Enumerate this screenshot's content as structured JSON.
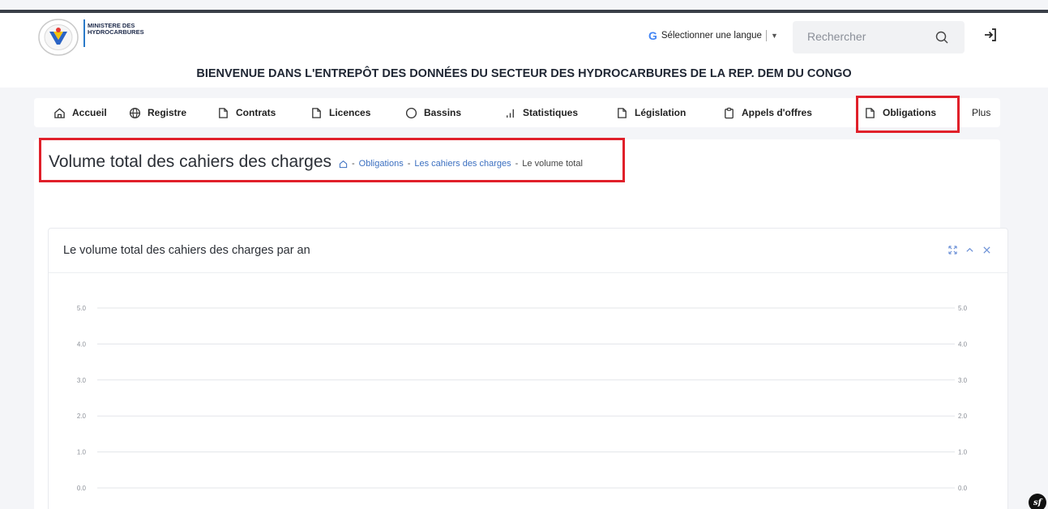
{
  "header": {
    "logo_text": "MINISTERE DES HYDROCARBURES",
    "language_label": "Sélectionner une langue",
    "language_arrow": "▼",
    "search_placeholder": "Rechercher",
    "welcome": "BIENVENUE DANS L'ENTREPÔT DES DONNÉES DU SECTEUR DES HYDROCARBURES DE LA REP. DEM DU CONGO"
  },
  "nav": {
    "items": [
      {
        "label": "Accueil",
        "icon": "home-icon"
      },
      {
        "label": "Registre",
        "icon": "globe-icon"
      },
      {
        "label": "Contrats",
        "icon": "document-icon"
      },
      {
        "label": "Licences",
        "icon": "document-icon"
      },
      {
        "label": "Bassins",
        "icon": "circle-icon"
      },
      {
        "label": "Statistiques",
        "icon": "bar-chart-icon"
      },
      {
        "label": "Législation",
        "icon": "document-icon"
      },
      {
        "label": "Appels d'offres",
        "icon": "clipboard-icon"
      },
      {
        "label": "Obligations",
        "icon": "document-icon",
        "active": true
      },
      {
        "label": "Plus"
      }
    ]
  },
  "page": {
    "title": "Volume total des cahiers des charges",
    "breadcrumb": [
      "Obligations",
      "Les cahiers des charges",
      "Le volume total"
    ],
    "breadcrumb_sep": "-"
  },
  "card": {
    "title": "Le volume total des cahiers des charges par an"
  },
  "chart_data": {
    "type": "line",
    "ylim": [
      0,
      5
    ],
    "yticks": [
      "0.0",
      "1.0",
      "2.0",
      "3.0",
      "4.0",
      "5.0"
    ],
    "series": [],
    "dual_y_axis": true
  },
  "colors": {
    "highlight": "#e0202a",
    "link": "#3b6fc0",
    "topline": "#3a3f48"
  }
}
